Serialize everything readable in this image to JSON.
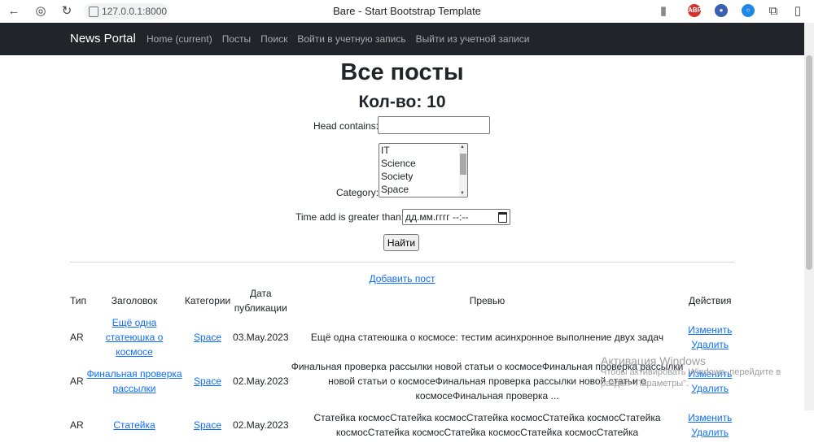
{
  "browser": {
    "url": "127.0.0.1:8000",
    "tab_title": "Bare - Start Bootstrap Template"
  },
  "navbar": {
    "brand": "News Portal",
    "links": [
      "Home (current)",
      "Посты",
      "Поиск",
      "Войти в учетную запись",
      "Выйти из учетной записи"
    ]
  },
  "page": {
    "title": "Все посты",
    "count": "Кол-во: 10"
  },
  "filter": {
    "head_label": "Head contains:",
    "head_value": "",
    "category_label": "Category:",
    "category_options": [
      "IT",
      "Science",
      "Society",
      "Space"
    ],
    "time_label": "Time add is greater than:",
    "time_placeholder": "дд.мм.гггг --:--",
    "submit": "Найти"
  },
  "add_post": "Добавить пост",
  "table": {
    "headers": [
      "Тип",
      "Заголовок",
      "Категории",
      "Дата публикации",
      "Превью",
      "Действия"
    ],
    "rows": [
      {
        "type": "AR",
        "title": "Ещё одна статеюшка о космосе",
        "category": "Space",
        "date": "03.May.2023",
        "preview": "Ещё одна статеюшка о космосе: тестим асинхронное выполнение двух задач",
        "edit": "Изменить",
        "delete": "Удалить"
      },
      {
        "type": "AR",
        "title": "Финальная проверка рассылки",
        "category": "Space",
        "date": "02.May.2023",
        "preview": "Финальная проверка рассылки новой статьи о космосеФинальная проверка рассылки новой статьи о космосеФинальная проверка рассылки новой статьи о космосеФинальная проверка ...",
        "edit": "Изменить",
        "delete": "Удалить"
      },
      {
        "type": "AR",
        "title": "Статейка",
        "category": "Space",
        "date": "02.May.2023",
        "preview": "Статейка космосСтатейка космосСтатейка космосСтатейка космосСтатейка космосСтатейка космосСтатейка космосСтатейка космосСтатейка",
        "edit": "Изменить",
        "delete": "Удалить"
      }
    ]
  },
  "watermark": {
    "line1": "Активация Windows",
    "line2": "Чтобы активировать Windows, перейдите в",
    "line3": "раздел \"Параметры\"."
  }
}
